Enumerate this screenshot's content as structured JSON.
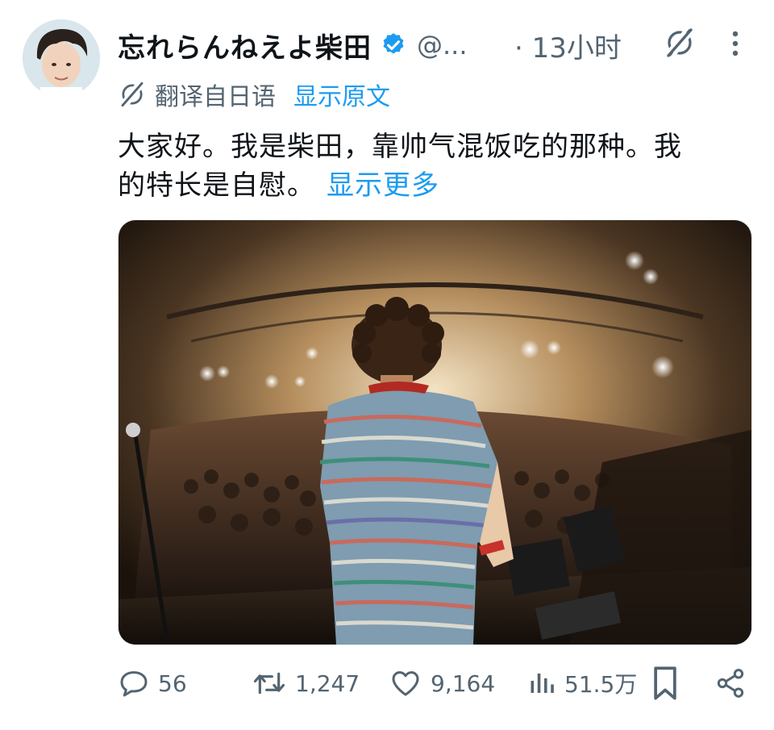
{
  "tweet": {
    "display_name": "忘れらんねえよ柴田",
    "handle": "@...",
    "timestamp": "· 13小时",
    "translate_label": "翻译自日语",
    "show_original_label": "显示原文",
    "text_line1": "大家好。我是柴田，靠帅气混饭吃的那种。我",
    "text_line2": "的特长是自慰。",
    "show_more_label": "显示更多"
  },
  "actions": {
    "replies": "56",
    "reposts": "1,247",
    "likes": "9,164",
    "views": "51.5万"
  },
  "colors": {
    "link": "#1d9bf0",
    "secondary_text": "#536471",
    "verified": "#1d9bf0"
  },
  "icons": {
    "verified": "verified-badge-icon",
    "grok": "grok-icon",
    "more": "more-vertical-icon",
    "reply": "reply-icon",
    "repost": "repost-icon",
    "like": "heart-icon",
    "views": "views-icon",
    "bookmark": "bookmark-icon",
    "share": "share-icon"
  }
}
